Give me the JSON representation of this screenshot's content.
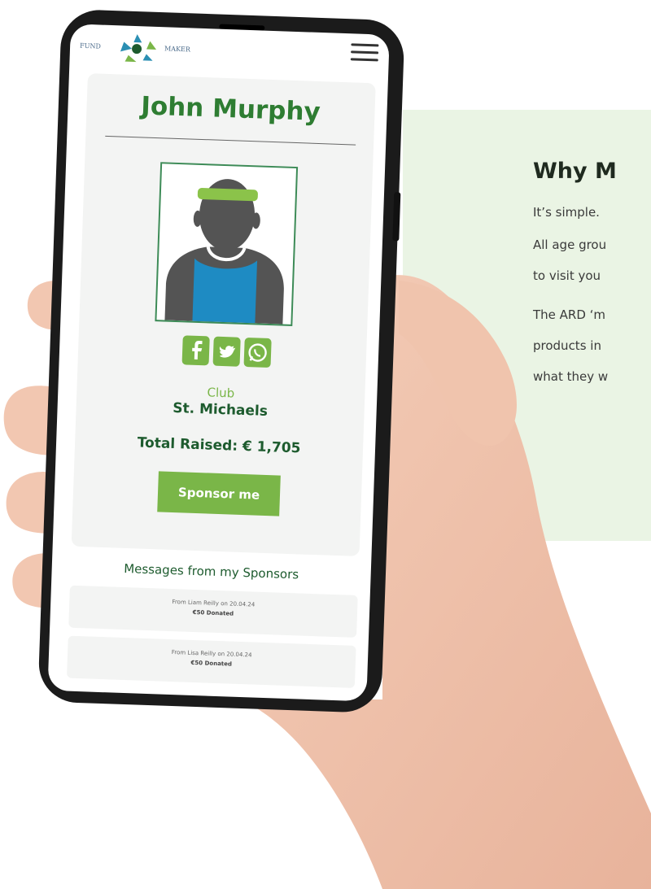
{
  "profile": {
    "name": "John Murphy",
    "club_label": "Club",
    "club_name": "St. Michaels",
    "total_raised": "Total Raised: € 1,705",
    "sponsor_button": "Sponsor me"
  },
  "logo": {
    "left_text": "FUND",
    "right_text": "MAKER"
  },
  "social": [
    "facebook-icon",
    "twitter-icon",
    "whatsapp-icon"
  ],
  "messages": {
    "title": "Messages from my Sponsors",
    "items": [
      {
        "from": "From Liam Reilly on 20.04.24",
        "amount": "€50 Donated"
      },
      {
        "from": "From Lisa Reilly on 20.04.24",
        "amount": "€50 Donated"
      }
    ]
  },
  "why": {
    "title": "Why M",
    "lines": [
      "It’s simple.",
      "All age grou",
      "to visit you",
      "The ARD ‘m",
      "products in",
      "what they w"
    ]
  },
  "colors": {
    "brand_green": "#7ab648",
    "dark_green": "#1d5b2e",
    "panel_bg": "#eaf4e4"
  }
}
